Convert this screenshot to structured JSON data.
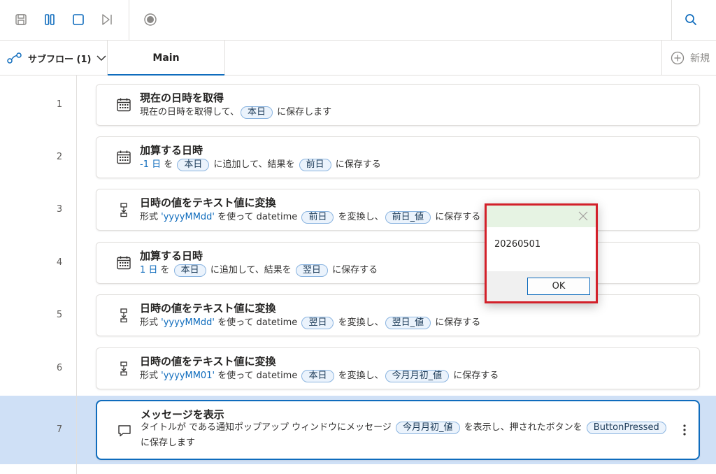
{
  "toolbar": {
    "buttons": [
      "save-icon",
      "pause-icon",
      "stop-icon",
      "step-next-icon",
      "record-icon",
      "search-icon"
    ]
  },
  "tabs": {
    "subflow_label": "サブフロー (1)",
    "main_label": "Main",
    "new_label": "新規"
  },
  "steps": [
    {
      "num": "1",
      "title": "現在の日時を取得",
      "icon": "calendar-icon",
      "desc": [
        {
          "t": "text",
          "v": "現在の日時を取得して、"
        },
        {
          "t": "var",
          "v": "本日"
        },
        {
          "t": "text",
          "v": " に保存します"
        }
      ]
    },
    {
      "num": "2",
      "title": "加算する日時",
      "icon": "calendar-icon",
      "desc": [
        {
          "t": "lit",
          "v": "-1 日"
        },
        {
          "t": "text",
          "v": " を "
        },
        {
          "t": "var",
          "v": "本日"
        },
        {
          "t": "text",
          "v": " に追加して、結果を "
        },
        {
          "t": "var",
          "v": "前日"
        },
        {
          "t": "text",
          "v": " に保存する"
        }
      ]
    },
    {
      "num": "3",
      "title": "日時の値をテキスト値に変換",
      "icon": "convert-icon",
      "desc": [
        {
          "t": "text",
          "v": "形式 "
        },
        {
          "t": "lit",
          "v": "'yyyyMMdd'"
        },
        {
          "t": "text",
          "v": " を使って datetime "
        },
        {
          "t": "var",
          "v": "前日"
        },
        {
          "t": "text",
          "v": " を変換し、"
        },
        {
          "t": "var",
          "v": "前日_値"
        },
        {
          "t": "text",
          "v": " に保存する"
        }
      ]
    },
    {
      "num": "4",
      "title": "加算する日時",
      "icon": "calendar-icon",
      "desc": [
        {
          "t": "lit",
          "v": "1 日"
        },
        {
          "t": "text",
          "v": " を "
        },
        {
          "t": "var",
          "v": "本日"
        },
        {
          "t": "text",
          "v": " に追加して、結果を "
        },
        {
          "t": "var",
          "v": "翌日"
        },
        {
          "t": "text",
          "v": " に保存する"
        }
      ]
    },
    {
      "num": "5",
      "title": "日時の値をテキスト値に変換",
      "icon": "convert-icon",
      "desc": [
        {
          "t": "text",
          "v": "形式 "
        },
        {
          "t": "lit",
          "v": "'yyyyMMdd'"
        },
        {
          "t": "text",
          "v": " を使って datetime "
        },
        {
          "t": "var",
          "v": "翌日"
        },
        {
          "t": "text",
          "v": " を変換し、"
        },
        {
          "t": "var",
          "v": "翌日_値"
        },
        {
          "t": "text",
          "v": " に保存する"
        }
      ]
    },
    {
      "num": "6",
      "title": "日時の値をテキスト値に変換",
      "icon": "convert-icon",
      "desc": [
        {
          "t": "text",
          "v": "形式 "
        },
        {
          "t": "lit",
          "v": "'yyyyMM01'"
        },
        {
          "t": "text",
          "v": " を使って datetime "
        },
        {
          "t": "var",
          "v": "本日"
        },
        {
          "t": "text",
          "v": " を変換し、"
        },
        {
          "t": "var",
          "v": "今月月初_値"
        },
        {
          "t": "text",
          "v": " に保存する"
        }
      ]
    },
    {
      "num": "7",
      "title": "メッセージを表示",
      "icon": "message-icon",
      "selected": true,
      "desc": [
        {
          "t": "text",
          "v": "タイトルが  である通知ポップアップ ウィンドウにメッセージ "
        },
        {
          "t": "var",
          "v": "今月月初_値"
        },
        {
          "t": "text",
          "v": " を表示し、押されたボタンを "
        },
        {
          "t": "var",
          "v": "ButtonPressed"
        },
        {
          "t": "text",
          "v": " に保存します"
        }
      ]
    }
  ],
  "dialog": {
    "message": "20260501",
    "ok_label": "OK"
  },
  "colors": {
    "accent": "#0f6cbd",
    "selected_band": "#cfe0f6",
    "dialog_border": "#d3202a",
    "dialog_title_bg": "#e6f3e3"
  }
}
